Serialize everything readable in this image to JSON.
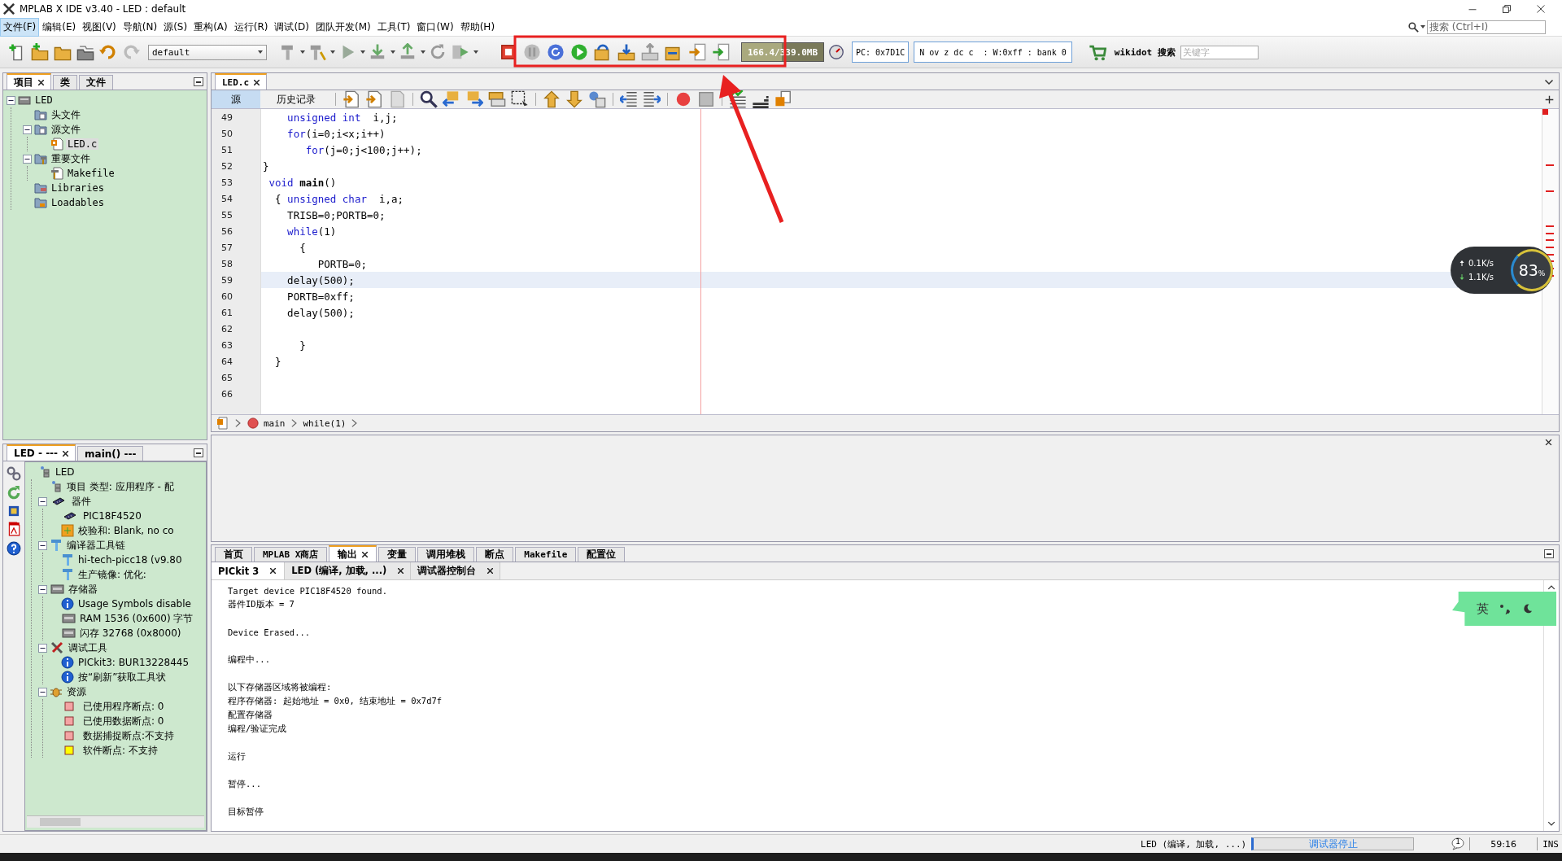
{
  "window": {
    "title": "MPLAB X IDE v3.40 - LED : default"
  },
  "menu": [
    {
      "label": "文件(F)",
      "selected": true
    },
    {
      "label": "编辑(E)",
      "selected": false
    },
    {
      "label": "视图(V)",
      "selected": false
    },
    {
      "label": "导航(N)",
      "selected": false
    },
    {
      "label": "源(S)",
      "selected": false
    },
    {
      "label": "重构(A)",
      "selected": false
    },
    {
      "label": "运行(R)",
      "selected": false
    },
    {
      "label": "调试(D)",
      "selected": false
    },
    {
      "label": "团队开发(M)",
      "selected": false
    },
    {
      "label": "工具(T)",
      "selected": false
    },
    {
      "label": "窗口(W)",
      "selected": false
    },
    {
      "label": "帮助(H)",
      "selected": false
    }
  ],
  "search": {
    "placeholder": "搜索 (Ctrl+I)"
  },
  "toolbar": {
    "configuration": "default",
    "memory": {
      "reading": "166.4/339.0MB",
      "level": 0.49
    },
    "pc": "PC: 0x7D1C",
    "status_bits": "N ov z dc c  : W:0xff : bank 0",
    "web_search": {
      "label": "wikidot 搜索",
      "placeholder": "关键字"
    }
  },
  "project_panel": {
    "tabs": [
      {
        "label": "项目",
        "selected": true
      },
      {
        "label": "类",
        "selected": false
      },
      {
        "label": "文件",
        "selected": false
      }
    ],
    "tree": [
      {
        "label": "LED",
        "kind": "project",
        "selected": false,
        "expanded": true,
        "children": [
          {
            "label": "头文件",
            "kind": "folder",
            "selected": false
          },
          {
            "label": "源文件",
            "kind": "folder",
            "selected": false,
            "expanded": true,
            "children": [
              {
                "label": "LED.c",
                "kind": "c-file",
                "selected": true
              }
            ]
          },
          {
            "label": "重要文件",
            "kind": "folder-tool",
            "selected": false,
            "expanded": true,
            "children": [
              {
                "label": "Makefile",
                "kind": "makefile",
                "selected": false
              }
            ]
          },
          {
            "label": "Libraries",
            "kind": "folder-lib",
            "selected": false
          },
          {
            "label": "Loadables",
            "kind": "folder-load",
            "selected": false
          }
        ]
      }
    ]
  },
  "dashboard": {
    "tabs": [
      {
        "label": "LED - ---",
        "selected": true
      },
      {
        "label": "main() ---",
        "selected": false
      }
    ],
    "tree": [
      {
        "label": "LED",
        "kind": "node",
        "children": [
          {
            "label": "项目 类型: 应用程序 - 配",
            "kind": "node"
          },
          {
            "label": "器件",
            "kind": "chip",
            "expanded": true,
            "children": [
              {
                "label": "PIC18F4520",
                "kind": "chip"
              },
              {
                "label": "校验和: Blank, no co",
                "kind": "checksum"
              }
            ]
          },
          {
            "label": "编译器工具链",
            "kind": "tool",
            "expanded": true,
            "children": [
              {
                "label": "hi-tech-picc18 (v9.80",
                "kind": "tool"
              },
              {
                "label": "生产镜像: 优化:",
                "kind": "tool"
              }
            ]
          },
          {
            "label": "存储器",
            "kind": "memory",
            "expanded": true,
            "children": [
              {
                "label": "Usage Symbols disable",
                "kind": "info"
              },
              {
                "label": "RAM 1536 (0x600) 字节",
                "kind": "memory"
              },
              {
                "label": "闪存 32768 (0x8000)",
                "kind": "memory"
              }
            ]
          },
          {
            "label": "调试工具",
            "kind": "debugtool",
            "expanded": true,
            "children": [
              {
                "label": "PICkit3: BUR13228445",
                "kind": "info"
              },
              {
                "label": "按“刷新”获取工具状",
                "kind": "info"
              }
            ]
          },
          {
            "label": "资源",
            "kind": "bug",
            "expanded": true,
            "children": [
              {
                "label": "已使用程序断点: 0",
                "kind": "square",
                "color": "#f4a4a4"
              },
              {
                "label": "已使用数据断点: 0",
                "kind": "square",
                "color": "#f4a4a4"
              },
              {
                "label": "数据捕捉断点:不支持",
                "kind": "square",
                "color": "#f4a4a4"
              },
              {
                "label": "软件断点: 不支持",
                "kind": "square",
                "color": "#ffff00"
              }
            ]
          }
        ]
      }
    ]
  },
  "editor": {
    "tab": "LED.c",
    "views": [
      {
        "label": "源",
        "selected": true
      },
      {
        "label": "历史记录",
        "selected": false
      }
    ],
    "lines": [
      {
        "number": "49",
        "current": false,
        "segments": [
          {
            "kind": "keyword",
            "text": "    unsigned int"
          },
          {
            "kind": "plain",
            "text": "  i,j;"
          }
        ]
      },
      {
        "number": "50",
        "current": false,
        "segments": [
          {
            "kind": "keyword",
            "text": "    for"
          },
          {
            "kind": "plain",
            "text": "(i=0;i<x;i++)"
          }
        ]
      },
      {
        "number": "51",
        "current": false,
        "segments": [
          {
            "kind": "keyword",
            "text": "       for"
          },
          {
            "kind": "plain",
            "text": "(j=0;j<100;j++);"
          }
        ]
      },
      {
        "number": "52",
        "current": false,
        "segments": [
          {
            "kind": "plain",
            "text": "}"
          }
        ]
      },
      {
        "number": "53",
        "current": false,
        "segments": [
          {
            "kind": "keyword",
            "text": " void "
          },
          {
            "kind": "bold",
            "text": "main"
          },
          {
            "kind": "plain",
            "text": "()"
          }
        ]
      },
      {
        "number": "54",
        "current": false,
        "segments": [
          {
            "kind": "plain",
            "text": "  { "
          },
          {
            "kind": "keyword",
            "text": "unsigned char"
          },
          {
            "kind": "plain",
            "text": "  i,a;"
          }
        ]
      },
      {
        "number": "55",
        "current": false,
        "segments": [
          {
            "kind": "plain",
            "text": "    TRISB=0;PORTB=0;"
          }
        ]
      },
      {
        "number": "56",
        "current": false,
        "segments": [
          {
            "kind": "keyword",
            "text": "    while"
          },
          {
            "kind": "plain",
            "text": "(1)"
          }
        ]
      },
      {
        "number": "57",
        "current": false,
        "segments": [
          {
            "kind": "plain",
            "text": "      {"
          }
        ]
      },
      {
        "number": "58",
        "current": false,
        "segments": [
          {
            "kind": "plain",
            "text": "         PORTB=0;"
          }
        ]
      },
      {
        "number": "59",
        "current": true,
        "segments": [
          {
            "kind": "plain",
            "text": "    delay(500);"
          }
        ]
      },
      {
        "number": "60",
        "current": false,
        "segments": [
          {
            "kind": "plain",
            "text": "    PORTB=0xff;"
          }
        ]
      },
      {
        "number": "61",
        "current": false,
        "segments": [
          {
            "kind": "plain",
            "text": "    delay(500);"
          }
        ]
      },
      {
        "number": "62",
        "current": false
      },
      {
        "number": "63",
        "current": false,
        "segments": [
          {
            "kind": "plain",
            "text": "      }"
          }
        ]
      },
      {
        "number": "64",
        "current": false,
        "segments": [
          {
            "kind": "plain",
            "text": "  }"
          }
        ]
      },
      {
        "number": "65",
        "current": false
      },
      {
        "number": "66",
        "current": false
      }
    ],
    "breadcrumbs": [
      "main",
      "while(1)"
    ]
  },
  "output": {
    "tabs": [
      {
        "label": "首页",
        "selected": false
      },
      {
        "label": "MPLAB X商店",
        "selected": false
      },
      {
        "label": "输出",
        "selected": true
      },
      {
        "label": "变量",
        "selected": false
      },
      {
        "label": "调用堆栈",
        "selected": false
      },
      {
        "label": "断点",
        "selected": false
      },
      {
        "label": "Makefile",
        "selected": false
      },
      {
        "label": "配置位",
        "selected": false
      }
    ],
    "subtabs": [
      {
        "label": "PICkit 3",
        "selected": true
      },
      {
        "label": "LED (编译, 加载, ...)",
        "selected": false
      },
      {
        "label": "调试器控制台",
        "selected": false
      }
    ],
    "blocks": [
      [
        "Target device PIC18F4520 found.",
        "器件ID版本 = 7"
      ],
      [
        "Device Erased..."
      ],
      [
        "编程中..."
      ],
      [
        "以下存储器区域将被编程:",
        "程序存储器: 起始地址 = 0x0, 结束地址 = 0x7d7f",
        "配置存储器",
        "编程/验证完成"
      ],
      [
        "运行"
      ],
      [
        "暂停..."
      ],
      [
        "目标暂停"
      ]
    ]
  },
  "status_bar": {
    "task": "LED (编译, 加载, ...)",
    "progress_text": "调试器停止",
    "notifications": "1",
    "position": "59:16",
    "mode": "INS"
  },
  "network_widget": {
    "upload": "0.1K/s",
    "download": "1.1K/s",
    "usage": "83",
    "unit": "%"
  },
  "ime": {
    "label": "英"
  }
}
